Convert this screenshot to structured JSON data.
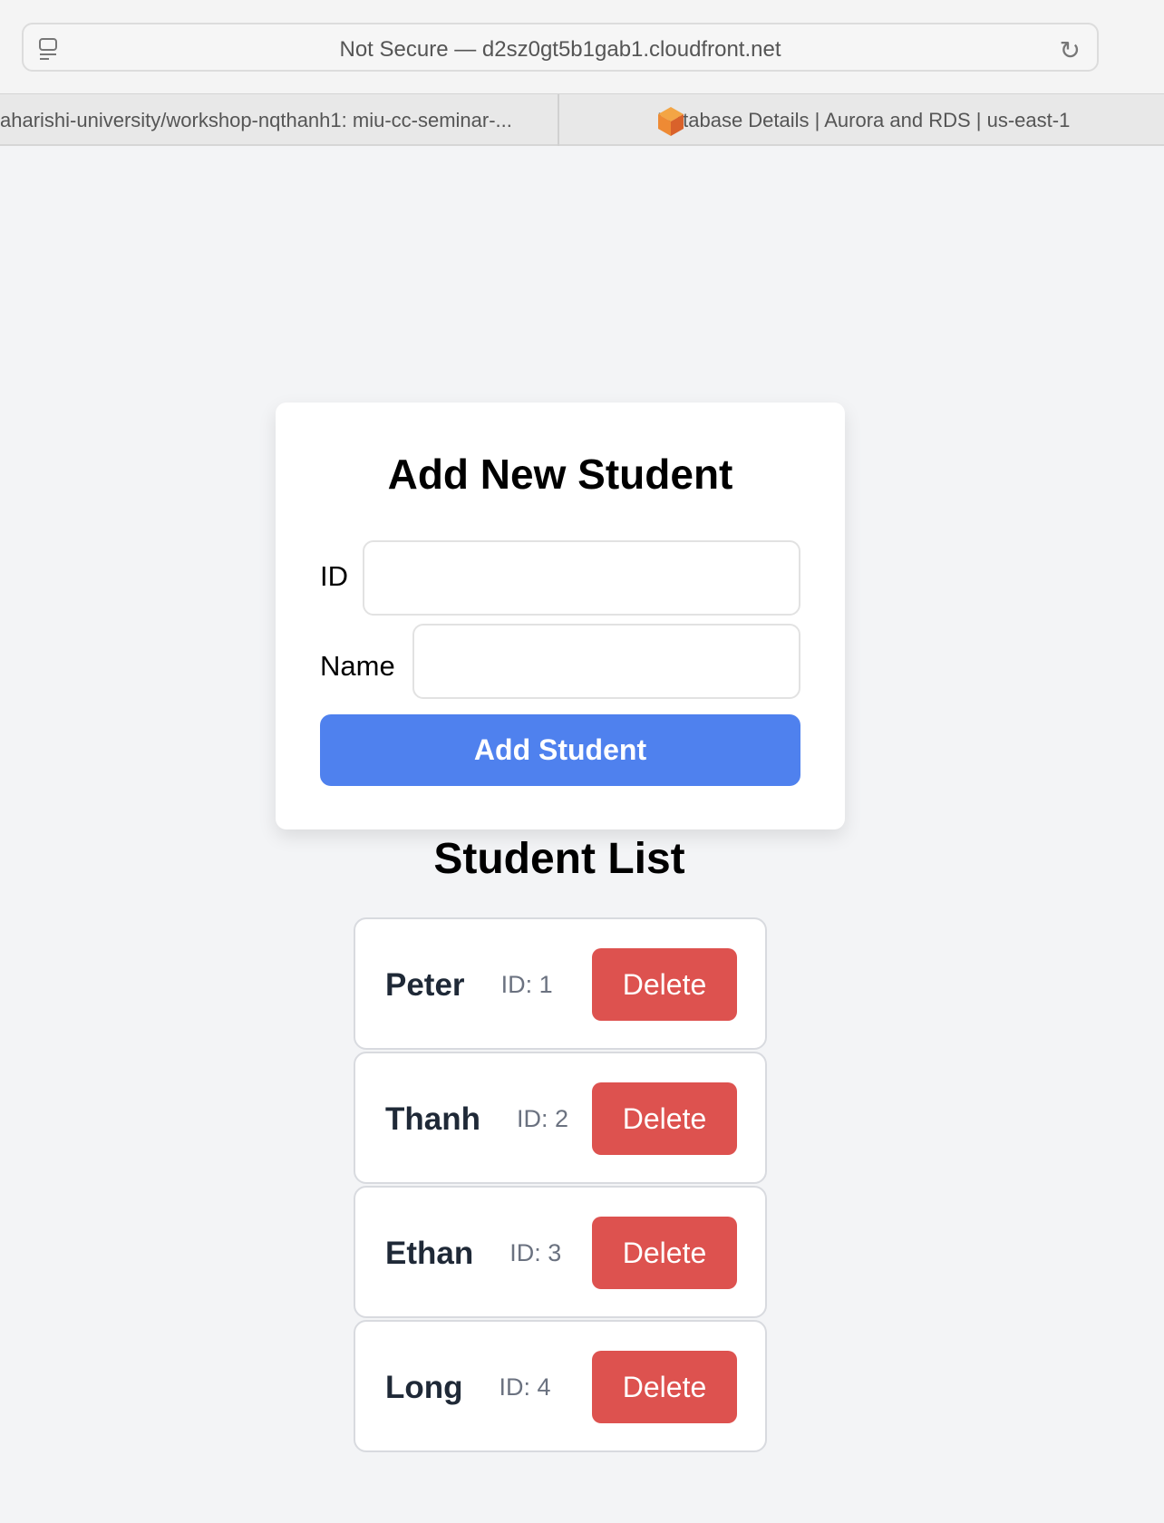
{
  "browser": {
    "url": "Not Secure — d2sz0gt5b1gab1.cloudfront.net",
    "tabs": [
      {
        "title": "aharishi-university/workshop-nqthanh1: miu-cc-seminar-..."
      },
      {
        "title": "Database Details | Aurora and RDS | us-east-1"
      }
    ]
  },
  "form": {
    "title": "Add New Student",
    "id_label": "ID",
    "id_value": "",
    "name_label": "Name",
    "name_value": "",
    "submit_label": "Add Student"
  },
  "list": {
    "title": "Student List",
    "delete_label": "Delete",
    "students": [
      {
        "name": "Peter",
        "id": "ID: 1"
      },
      {
        "name": "Thanh",
        "id": "ID: 2"
      },
      {
        "name": "Ethan",
        "id": "ID: 3"
      },
      {
        "name": "Long",
        "id": "ID: 4"
      }
    ]
  },
  "colors": {
    "primary": "#4f81ee",
    "danger": "#dd524f"
  }
}
